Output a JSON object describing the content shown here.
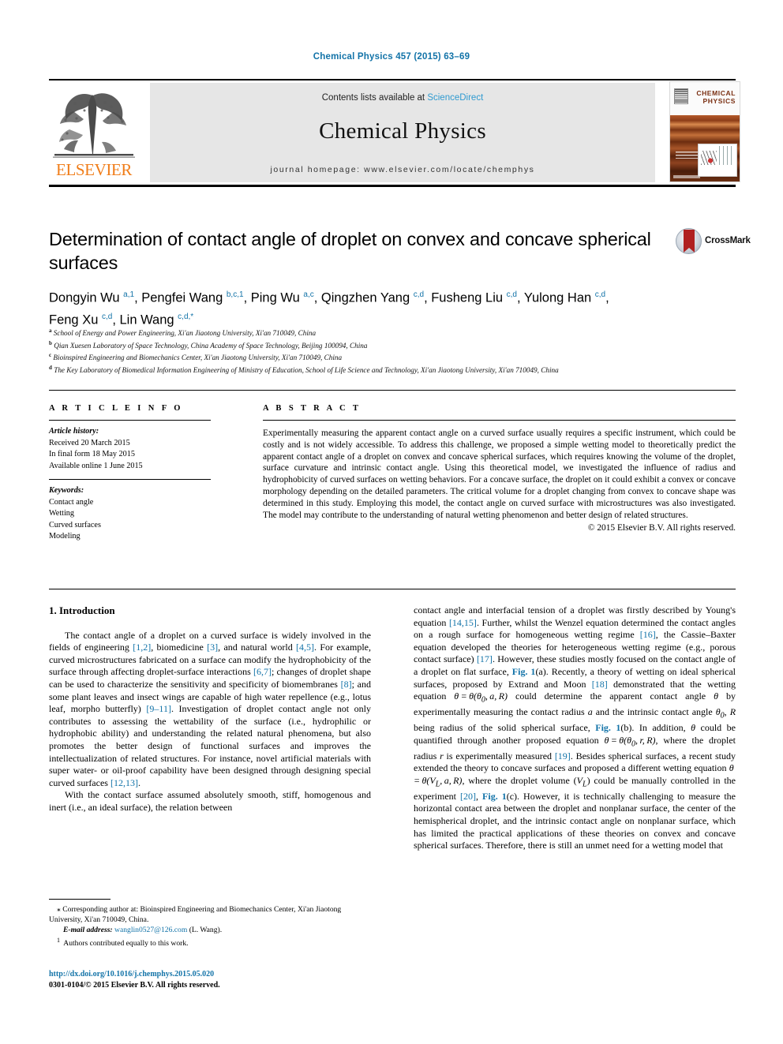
{
  "running_head": "Chemical Physics 457 (2015) 63–69",
  "header": {
    "contents_prefix": "Contents lists available at ",
    "sciencedirect": "ScienceDirect",
    "journal_title": "Chemical Physics",
    "homepage": "journal homepage: www.elsevier.com/locate/chemphys",
    "publisher_logo_text": "ELSEVIER",
    "cover_title_line1": "CHEMICAL",
    "cover_title_line2": "PHYSICS"
  },
  "article": {
    "title": "Determination of contact angle of droplet on convex and concave spherical surfaces",
    "crossmark_label": "CrossMark",
    "authors_line1_html": "Dongyin Wu <sup>a,1</sup>, Pengfei Wang <sup>b,c,1</sup>, Ping Wu <sup>a,c</sup>, Qingzhen Yang <sup>c,d</sup>, Fusheng Liu <sup>c,d</sup>, Yulong Han <sup>c,d</sup>,",
    "authors_line2_html": "Feng Xu <sup>c,d</sup>, Lin Wang <sup>c,d,&#42;</sup>",
    "affiliations": [
      "School of Energy and Power Engineering, Xi'an Jiaotong University, Xi'an 710049, China",
      "Qian Xuesen Laboratory of Space Technology, China Academy of Space Technology, Beijing 100094, China",
      "Bioinspired Engineering and Biomechanics Center, Xi'an Jiaotong University, Xi'an 710049, China",
      "The Key Laboratory of Biomedical Information Engineering of Ministry of Education, School of Life Science and Technology, Xi'an Jiaotong University, Xi'an 710049, China"
    ],
    "affiliation_marks": [
      "a",
      "b",
      "c",
      "d"
    ]
  },
  "article_info": {
    "heading": "A R T I C L E  I N F O",
    "history_label": "Article history:",
    "history": [
      "Received 20 March 2015",
      "In final form 18 May 2015",
      "Available online 1 June 2015"
    ],
    "keywords_label": "Keywords:",
    "keywords": [
      "Contact angle",
      "Wetting",
      "Curved surfaces",
      "Modeling"
    ]
  },
  "abstract": {
    "heading": "A B S T R A C T",
    "text": "Experimentally measuring the apparent contact angle on a curved surface usually requires a specific instrument, which could be costly and is not widely accessible. To address this challenge, we proposed a simple wetting model to theoretically predict the apparent contact angle of a droplet on convex and concave spherical surfaces, which requires knowing the volume of the droplet, surface curvature and intrinsic contact angle. Using this theoretical model, we investigated the influence of radius and hydrophobicity of curved surfaces on wetting behaviors. For a concave surface, the droplet on it could exhibit a convex or concave morphology depending on the detailed parameters. The critical volume for a droplet changing from convex to concave shape was determined in this study. Employing this model, the contact angle on curved surface with microstructures was also investigated. The model may contribute to the understanding of natural wetting phenomenon and better design of related structures.",
    "rights": "© 2015 Elsevier B.V. All rights reserved."
  },
  "body": {
    "section_heading": "1. Introduction",
    "left_paragraph_1_html": "The contact angle of a droplet on a curved surface is widely involved in the fields of engineering <span class=\"ref\">[1,2]</span>, biomedicine <span class=\"ref\">[3]</span>, and natural world <span class=\"ref\">[4,5]</span>. For example, curved microstructures fabricated on a surface can modify the hydrophobicity of the surface through affecting droplet-surface interactions <span class=\"ref\">[6,7]</span>; changes of droplet shape can be used to characterize the sensitivity and specificity of biomembranes <span class=\"ref\">[8]</span>; and some plant leaves and insect wings are capable of high water repellence (e.g., lotus leaf, morpho butterfly) <span class=\"ref\">[9&#8211;11]</span>. Investigation of droplet contact angle not only contributes to assessing the wettability of the surface (i.e., hydrophilic or hydrophobic ability) and understanding the related natural phenomena, but also promotes the better design of functional surfaces and improves the intellectualization of related structures. For instance, novel artificial materials with super water- or oil-proof capability have been designed through designing special curved surfaces <span class=\"ref\">[12,13]</span>.",
    "left_paragraph_2_html": "With the contact surface assumed absolutely smooth, stiff, homogenous and inert (i.e., an ideal surface), the relation between",
    "right_paragraph_1_html": "contact angle and interfacial tension of a droplet was firstly described by Young's equation <span class=\"ref\">[14,15]</span>. Further, whilst the Wenzel equation determined the contact angles on a rough surface for homogeneous wetting regime <span class=\"ref\">[16]</span>, the Cassie&#8211;Baxter equation developed the theories for heterogeneous wetting regime (e.g., porous contact surface) <span class=\"ref\">[17]</span>. However, these studies mostly focused on the contact angle of a droplet on flat surface, <span class=\"figref\">Fig. 1</span>(a). Recently, a theory of wetting on ideal spherical surfaces, proposed by Extrand and Moon <span class=\"ref\">[18]</span> demonstrated that the wetting equation <span class=\"mth\">&#952;&#8201;=&#8201;&#952;(&#952;<sub>0</sub>,&#8201;a,&#8201;R)</span> could determine the apparent contact angle <span class=\"mth\">&#952;</span> by experimentally measuring the contact radius <span class=\"mth\">a</span> and the intrinsic contact angle <span class=\"mth\">&#952;<sub>0</sub></span>, <span class=\"mth\">R</span> being radius of the solid spherical surface, <span class=\"figref\">Fig. 1</span>(b). In addition, <span class=\"mth\">&#952;</span> could be quantified through another proposed equation <span class=\"mth\">&#952;&#8201;=&#8201;&#952;(&#952;<sub>0</sub>,&#8201;r,&#8201;R)</span>, where the droplet radius <span class=\"mth\">r</span> is experimentally measured <span class=\"ref\">[19]</span>. Besides spherical surfaces, a recent study extended the theory to concave surfaces and proposed a different wetting equation <span class=\"mth\">&#952;&#8201;=&#8201;&#952;(V<sub>L</sub>,&#8201;a,&#8201;R)</span>, where the droplet volume (<span class=\"mth\">V<sub>L</sub></span>) could be manually controlled in the experiment <span class=\"ref\">[20]</span>, <span class=\"figref\">Fig. 1</span>(c). However, it is technically challenging to measure the horizontal contact area between the droplet and nonplanar surface, the center of the hemispherical droplet, and the intrinsic contact angle on nonplanar surface, which has limited the practical applications of these theories on convex and concave spherical surfaces. Therefore, there is still an unmet need for a wetting model that"
  },
  "footnotes": {
    "corresponding_html": "&#8270; Corresponding author at: Bioinspired Engineering and Biomechanics Center, Xi'an Jiaotong University, Xi'an 710049, China.",
    "email_label": "E-mail address:",
    "email": "wanglin0527@126.com",
    "email_suffix": "(L. Wang).",
    "equal_contribution_html": "<sup>1</sup>&#160; Authors contributed equally to this work."
  },
  "doi_block": {
    "doi_url": "http://dx.doi.org/10.1016/j.chemphys.2015.05.020",
    "issn_line": "0301-0104/© 2015 Elsevier B.V. All rights reserved."
  },
  "colors": {
    "link_blue": "#1273a8",
    "sciencedirect_blue": "#2f9ad0",
    "elsevier_orange": "#f07d19",
    "band_gray": "#e6e6e6"
  }
}
